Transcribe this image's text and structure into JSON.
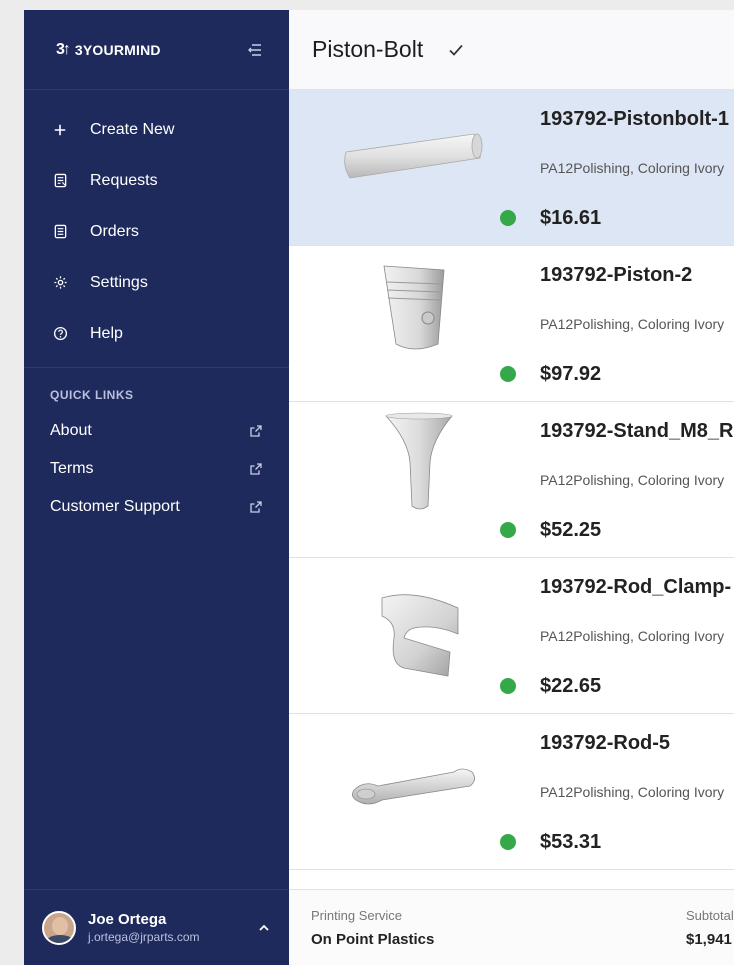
{
  "sidebar": {
    "brand": {
      "mark": "3↑",
      "name": "3YOURMIND"
    },
    "menu": [
      {
        "label": "Create New",
        "icon": "plus-icon"
      },
      {
        "label": "Requests",
        "icon": "requests-icon"
      },
      {
        "label": "Orders",
        "icon": "orders-icon"
      },
      {
        "label": "Settings",
        "icon": "gear-icon"
      },
      {
        "label": "Help",
        "icon": "help-icon"
      }
    ],
    "quick_links": {
      "title": "QUICK LINKS",
      "items": [
        {
          "label": "About",
          "icon": "external-link-icon"
        },
        {
          "label": "Terms",
          "icon": "external-link-icon"
        },
        {
          "label": "Customer Support",
          "icon": "external-link-icon"
        }
      ]
    },
    "user": {
      "name": "Joe Ortega",
      "email": "j.ortega@jrparts.com"
    }
  },
  "header": {
    "title": "Piston-Bolt"
  },
  "parts": [
    {
      "name": "193792-Pistonbolt-1",
      "material": "PA12Polishing, Coloring Ivory",
      "price": "$16.61",
      "status_color": "#35a84a",
      "icon": "cylinder-part"
    },
    {
      "name": "193792-Piston-2",
      "material": "PA12Polishing, Coloring Ivory",
      "price": "$97.92",
      "status_color": "#35a84a",
      "icon": "piston-part"
    },
    {
      "name": "193792-Stand_M8_R",
      "material": "PA12Polishing, Coloring Ivory",
      "price": "$52.25",
      "status_color": "#35a84a",
      "icon": "funnel-part"
    },
    {
      "name": "193792-Rod_Clamp-",
      "material": "PA12Polishing, Coloring Ivory",
      "price": "$22.65",
      "status_color": "#35a84a",
      "icon": "clamp-part"
    },
    {
      "name": "193792-Rod-5",
      "material": "PA12Polishing, Coloring Ivory",
      "price": "$53.31",
      "status_color": "#35a84a",
      "icon": "rod-part"
    }
  ],
  "footer": {
    "printing_service_label": "Printing Service",
    "printing_service_value": "On Point Plastics",
    "subtotal_label": "Subtotal",
    "subtotal_value": "$1,941"
  }
}
